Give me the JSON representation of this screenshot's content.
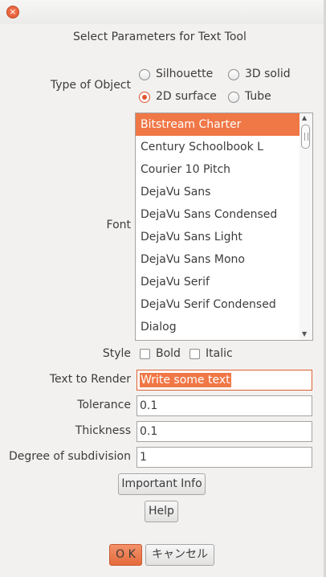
{
  "window": {
    "close_icon": "×"
  },
  "dialog_title": "Select Parameters for Text Tool",
  "object_type": {
    "label": "Type of Object",
    "options": [
      {
        "label": "Silhouette",
        "selected": false
      },
      {
        "label": "3D solid",
        "selected": false
      },
      {
        "label": "2D surface",
        "selected": true
      },
      {
        "label": "Tube",
        "selected": false
      }
    ]
  },
  "font": {
    "label": "Font",
    "items": [
      "Bitstream Charter",
      "Century Schoolbook L",
      "Courier 10 Pitch",
      "DejaVu Sans",
      "DejaVu Sans Condensed",
      "DejaVu Sans Light",
      "DejaVu Sans Mono",
      "DejaVu Serif",
      "DejaVu Serif Condensed",
      "Dialog"
    ],
    "selected": "Bitstream Charter",
    "scroll_up_icon": "▲",
    "scroll_down_icon": "▼"
  },
  "style": {
    "label": "Style",
    "bold_label": "Bold",
    "italic_label": "Italic"
  },
  "text_to_render": {
    "label": "Text to Render",
    "value": "Write some text"
  },
  "tolerance": {
    "label": "Tolerance",
    "value": "0.1"
  },
  "thickness": {
    "label": "Thickness",
    "value": "0.1"
  },
  "subdivision": {
    "label": "Degree of subdivision",
    "value": "1"
  },
  "buttons": {
    "important_info": "Important Info",
    "help": "Help",
    "ok": "O K",
    "cancel": "キャンセル"
  },
  "colors": {
    "accent": "#f07746"
  }
}
